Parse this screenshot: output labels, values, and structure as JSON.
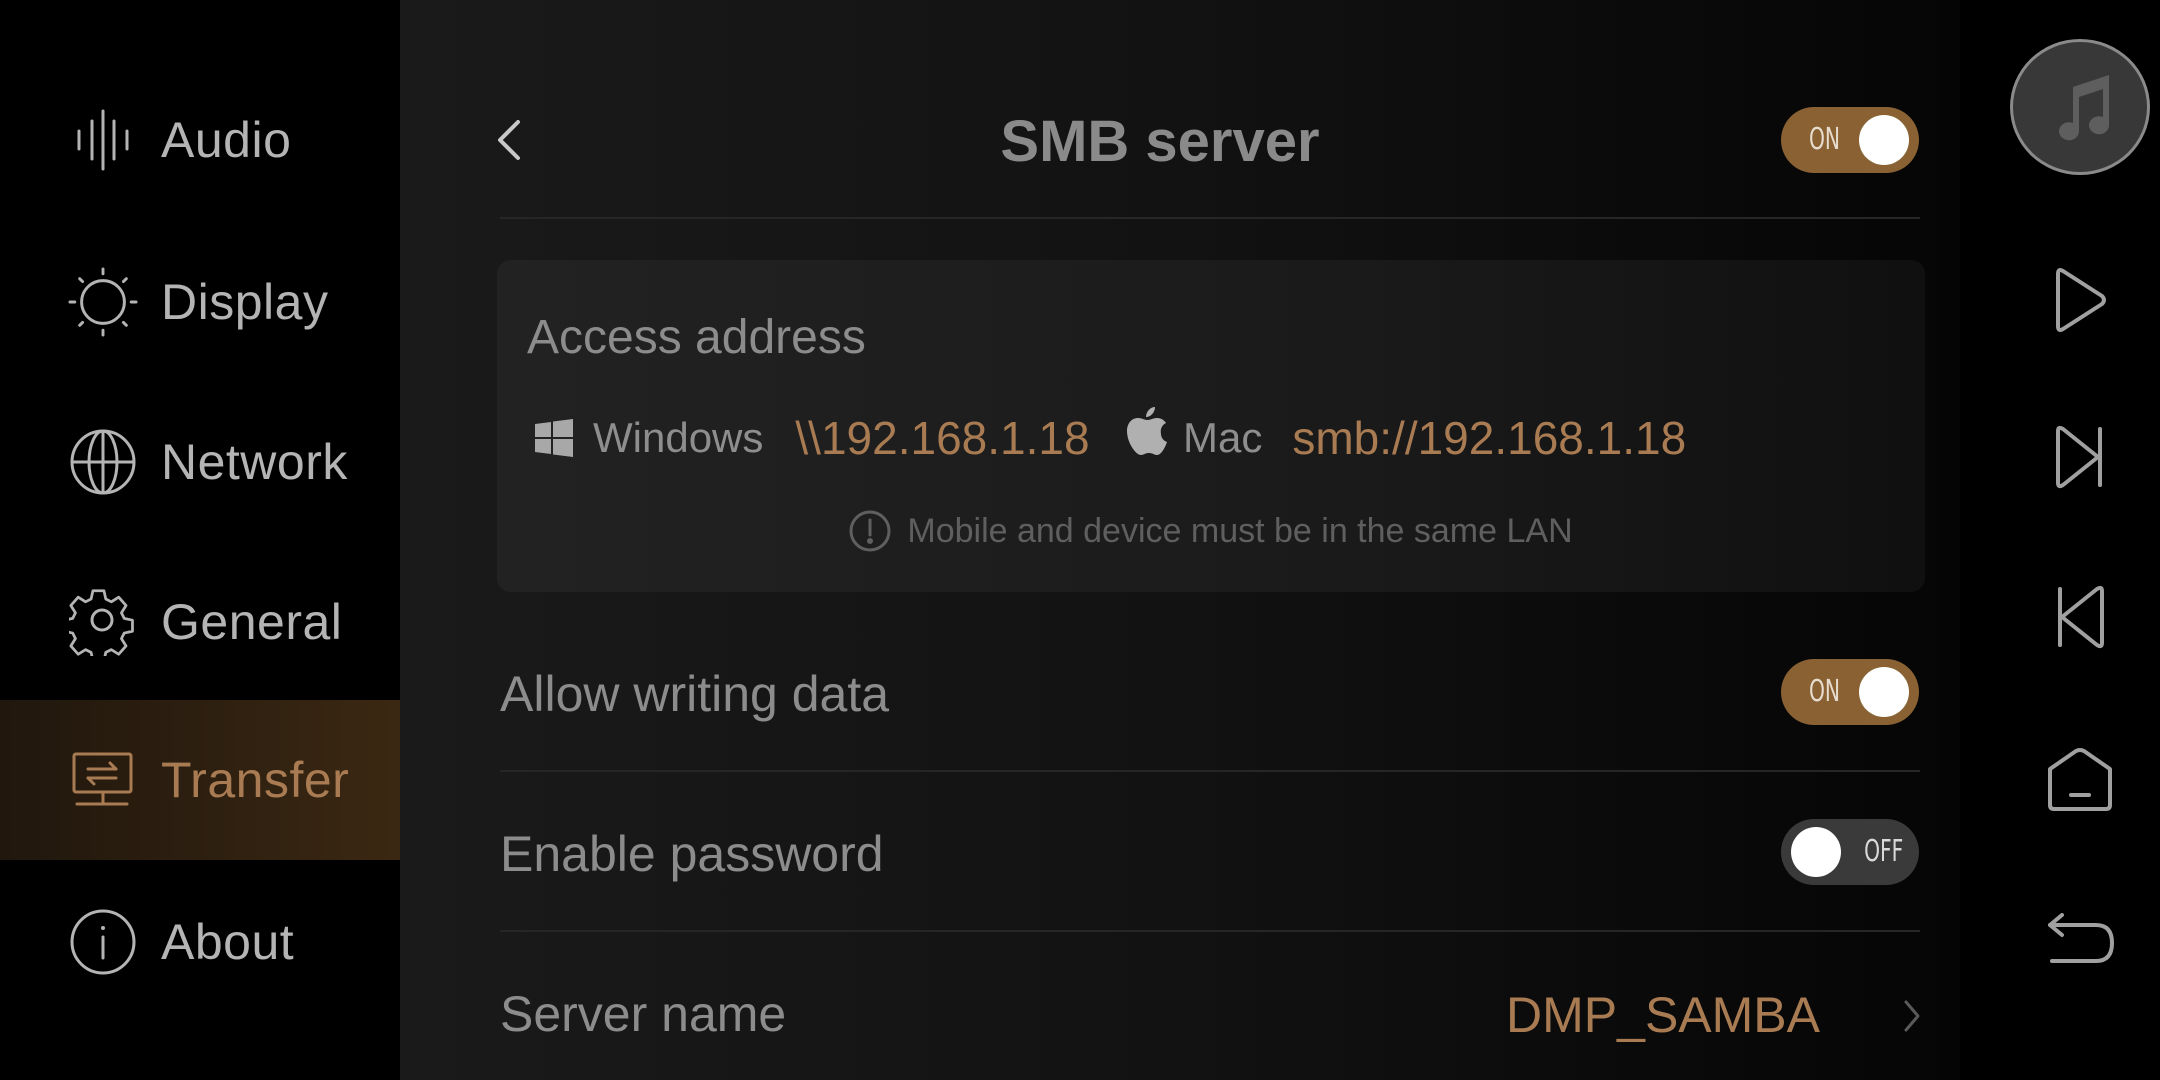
{
  "sidebar": {
    "items": [
      {
        "label": "Audio",
        "icon": "waveform-icon",
        "active": false
      },
      {
        "label": "Display",
        "icon": "brightness-icon",
        "active": false
      },
      {
        "label": "Network",
        "icon": "globe-icon",
        "active": false
      },
      {
        "label": "General",
        "icon": "gear-icon",
        "active": false
      },
      {
        "label": "Transfer",
        "icon": "transfer-monitor-icon",
        "active": true
      },
      {
        "label": "About",
        "icon": "info-icon",
        "active": false
      }
    ]
  },
  "header": {
    "title": "SMB server",
    "back_icon": "chevron-left-icon",
    "toggle": {
      "state": "ON",
      "on": true
    }
  },
  "access_card": {
    "title": "Access address",
    "windows": {
      "icon": "windows-logo-icon",
      "label": "Windows",
      "address": "\\\\192.168.1.18"
    },
    "mac": {
      "icon": "apple-logo-icon",
      "label": "Mac",
      "address": "smb://192.168.1.18"
    },
    "note": {
      "icon": "exclamation-circle-icon",
      "text": "Mobile and device must be in the same LAN"
    }
  },
  "settings": [
    {
      "label": "Allow writing data",
      "type": "toggle",
      "state": "ON",
      "on": true
    },
    {
      "label": "Enable password",
      "type": "toggle",
      "state": "OFF",
      "on": false
    },
    {
      "label": "Server name",
      "type": "link",
      "value": "DMP_SAMBA",
      "icon": "chevron-right-icon"
    }
  ],
  "controls": [
    {
      "name": "music-icon"
    },
    {
      "name": "play-icon"
    },
    {
      "name": "next-track-icon"
    },
    {
      "name": "previous-track-icon"
    },
    {
      "name": "home-icon"
    },
    {
      "name": "return-icon"
    }
  ],
  "colors": {
    "accent": "#a97b52",
    "toggle_on": "#8a6132",
    "toggle_off": "#3a3a3a",
    "text_primary": "#b4b4b4",
    "text_secondary": "#8c8c8c"
  }
}
